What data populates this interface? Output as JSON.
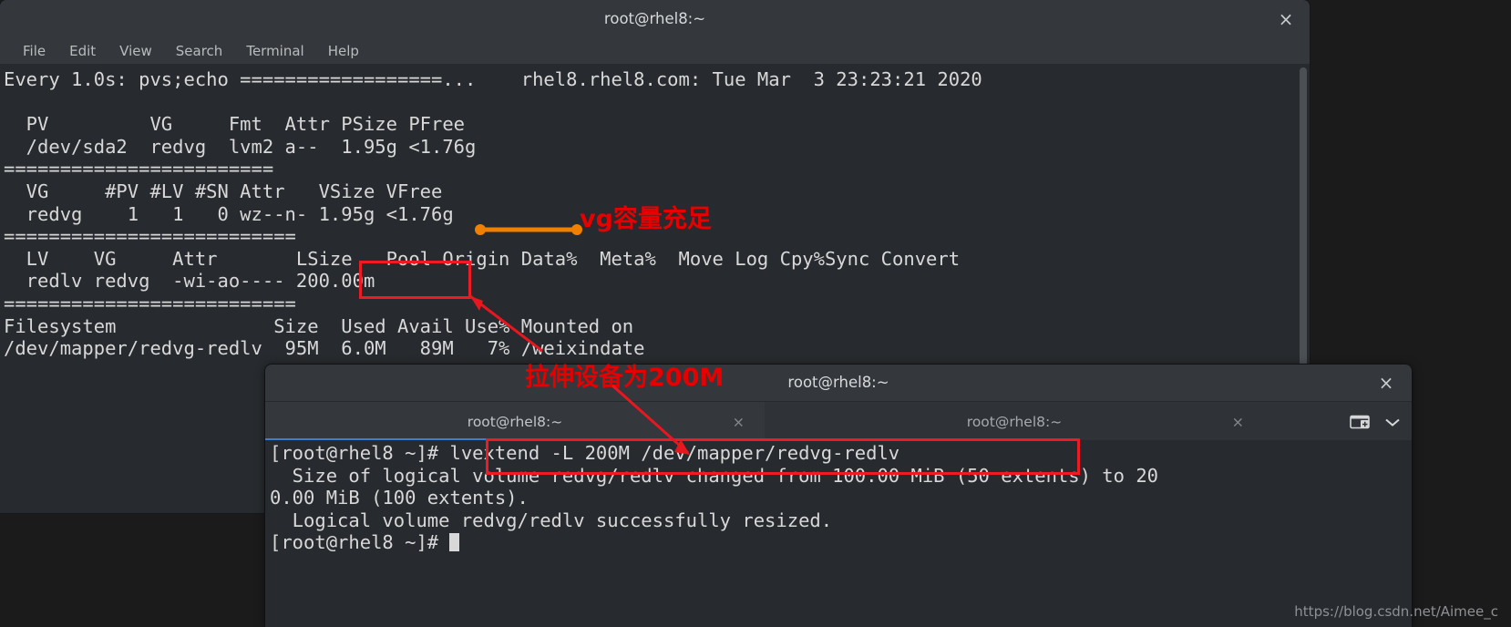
{
  "window1": {
    "title": "root@rhel8:~",
    "close_label": "×",
    "menu": [
      "File",
      "Edit",
      "View",
      "Search",
      "Terminal",
      "Help"
    ],
    "terminal_text": "Every 1.0s: pvs;echo ==================...    rhel8.rhel8.com: Tue Mar  3 23:23:21 2020\n\n  PV         VG     Fmt  Attr PSize PFree\n  /dev/sda2  redvg  lvm2 a--  1.95g <1.76g\n========================\n  VG     #PV #LV #SN Attr   VSize VFree\n  redvg    1   1   0 wz--n- 1.95g <1.76g\n==========================\n  LV    VG     Attr       LSize   Pool Origin Data%  Meta%  Move Log Cpy%Sync Convert\n  redlv redvg  -wi-ao---- 200.00m\n==========================\nFilesystem              Size  Used Avail Use% Mounted on\n/dev/mapper/redvg-redlv  95M  6.0M   89M   7% /weixindate"
  },
  "window2": {
    "title": "root@rhel8:~",
    "close_label": "×",
    "tabs": [
      {
        "label": "root@rhel8:~",
        "active": true,
        "close_label": "×"
      },
      {
        "label": "root@rhel8:~",
        "active": false,
        "close_label": "×"
      }
    ],
    "new_tab_icon": "new-tab-icon",
    "tab_menu_icon": "chevron-down-icon",
    "terminal_text": "[root@rhel8 ~]# lvextend -L 200M /dev/mapper/redvg-redlv\n  Size of logical volume redvg/redlv changed from 100.00 MiB (50 extents) to 20\n0.00 MiB (100 extents).\n  Logical volume redvg/redlv successfully resized.\n[root@rhel8 ~]# "
  },
  "annotations": {
    "vg_note": "vg容量充足",
    "extend_note": "拉伸设备为200M",
    "accent_red": "#ed1c24",
    "accent_orange": "#f08000"
  },
  "watermark": "https://blog.csdn.net/Aimee_c"
}
